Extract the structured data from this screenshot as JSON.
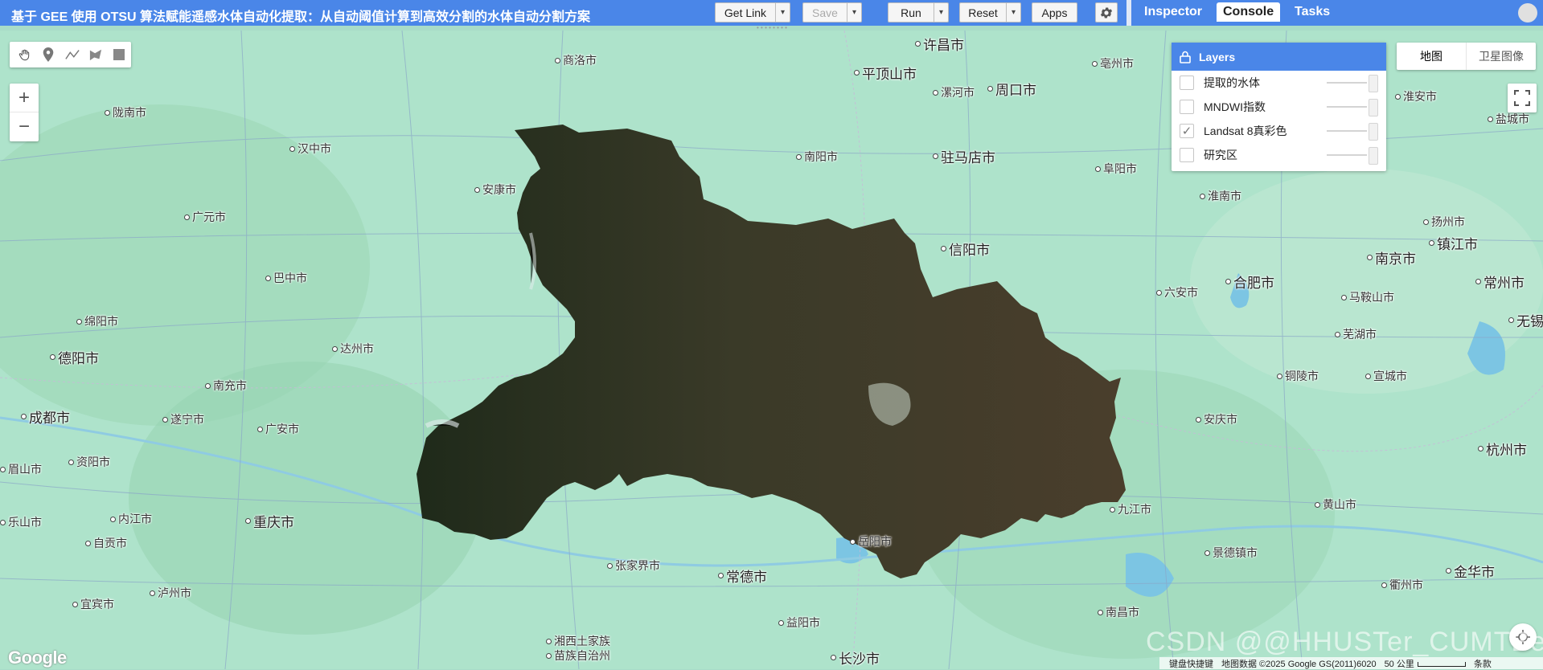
{
  "topbar": {
    "title": "基于 GEE 使用 OTSU 算法赋能遥感水体自动化提取：从自动阈值计算到高效分割的水体自动分割方案",
    "buttons": {
      "get_link": "Get Link",
      "save": "Save",
      "run": "Run",
      "reset": "Reset",
      "apps": "Apps"
    },
    "tabs": [
      "Inspector",
      "Console",
      "Tasks"
    ],
    "active_tab": "Console"
  },
  "layers_panel": {
    "title": "Layers",
    "layers": [
      {
        "name": "提取的水体",
        "checked": false
      },
      {
        "name": "MNDWI指数",
        "checked": false
      },
      {
        "name": "Landsat 8真彩色",
        "checked": true
      },
      {
        "name": "研究区",
        "checked": false
      }
    ]
  },
  "map_type": {
    "map": "地图",
    "satellite": "卫星图像",
    "selected": "地图"
  },
  "zoom": {
    "in": "+",
    "out": "−"
  },
  "cities": [
    {
      "name": "许昌市",
      "big": true
    },
    {
      "name": "商洛市",
      "big": false
    },
    {
      "name": "平顶山市",
      "big": true
    },
    {
      "name": "周口市",
      "big": true
    },
    {
      "name": "亳州市",
      "big": false
    },
    {
      "name": "陇南市",
      "big": false
    },
    {
      "name": "漯河市",
      "big": false
    },
    {
      "name": "淮安市",
      "big": false
    },
    {
      "name": "盐城市",
      "big": false
    },
    {
      "name": "汉中市",
      "big": false
    },
    {
      "name": "南阳市",
      "big": false
    },
    {
      "name": "驻马店市",
      "big": true
    },
    {
      "name": "阜阳市",
      "big": false
    },
    {
      "name": "安康市",
      "big": false
    },
    {
      "name": "淮南市",
      "big": false
    },
    {
      "name": "广元市",
      "big": false
    },
    {
      "name": "扬州市",
      "big": false
    },
    {
      "name": "信阳市",
      "big": true
    },
    {
      "name": "镇江市",
      "big": true
    },
    {
      "name": "巴中市",
      "big": false
    },
    {
      "name": "南京市",
      "big": true
    },
    {
      "name": "六安市",
      "big": false
    },
    {
      "name": "合肥市",
      "big": true
    },
    {
      "name": "常州市",
      "big": true
    },
    {
      "name": "马鞍山市",
      "big": false
    },
    {
      "name": "绵阳市",
      "big": false
    },
    {
      "name": "无锡",
      "big": true
    },
    {
      "name": "芜湖市",
      "big": false
    },
    {
      "name": "达州市",
      "big": false
    },
    {
      "name": "德阳市",
      "big": true
    },
    {
      "name": "铜陵市",
      "big": false
    },
    {
      "name": "宣城市",
      "big": false
    },
    {
      "name": "南充市",
      "big": false
    },
    {
      "name": "成都市",
      "big": true
    },
    {
      "name": "遂宁市",
      "big": false
    },
    {
      "name": "广安市",
      "big": false
    },
    {
      "name": "安庆市",
      "big": false
    },
    {
      "name": "杭州市",
      "big": true
    },
    {
      "name": "资阳市",
      "big": false
    },
    {
      "name": "眉山市",
      "big": false
    },
    {
      "name": "九江市",
      "big": false
    },
    {
      "name": "黄山市",
      "big": false
    },
    {
      "name": "内江市",
      "big": false
    },
    {
      "name": "重庆市",
      "big": true
    },
    {
      "name": "乐山市",
      "big": false
    },
    {
      "name": "岳阳市",
      "big": false
    },
    {
      "name": "自贡市",
      "big": false
    },
    {
      "name": "景德镇市",
      "big": false
    },
    {
      "name": "张家界市",
      "big": false
    },
    {
      "name": "常德市",
      "big": true
    },
    {
      "name": "金华市",
      "big": true
    },
    {
      "name": "衢州市",
      "big": false
    },
    {
      "name": "宜宾市",
      "big": false
    },
    {
      "name": "泸州市",
      "big": false
    },
    {
      "name": "南昌市",
      "big": false
    },
    {
      "name": "益阳市",
      "big": false
    },
    {
      "name": "湘西土家族",
      "big": false
    },
    {
      "name": "苗族自治州",
      "big": false
    },
    {
      "name": "长沙市",
      "big": true
    }
  ],
  "footer": {
    "shortcuts": "键盘快捷键",
    "attribution": "地图数据 ©2025 Google GS(2011)6020",
    "scale": "50 公里",
    "terms": "条款"
  },
  "watermark": "CSDN @@HHUSTer_CUMTBer",
  "google": "Google"
}
